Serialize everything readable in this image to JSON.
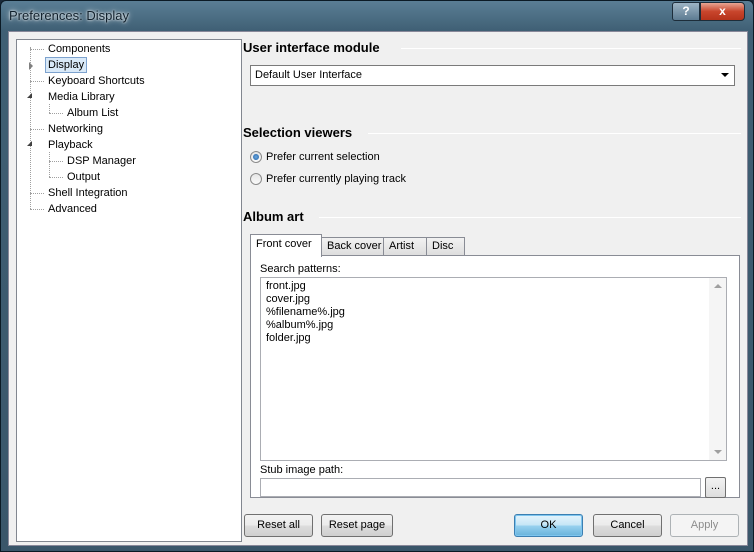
{
  "window": {
    "title": "Preferences: Display",
    "help_label": "?",
    "close_label": "x"
  },
  "tree": {
    "items": [
      {
        "label": "Components"
      },
      {
        "label": "Display"
      },
      {
        "label": "Keyboard Shortcuts"
      },
      {
        "label": "Media Library"
      },
      {
        "label": "Album List"
      },
      {
        "label": "Networking"
      },
      {
        "label": "Playback"
      },
      {
        "label": "DSP Manager"
      },
      {
        "label": "Output"
      },
      {
        "label": "Shell Integration"
      },
      {
        "label": "Advanced"
      }
    ]
  },
  "ui_module": {
    "header": "User interface module",
    "selected": "Default User Interface"
  },
  "selection_viewers": {
    "header": "Selection viewers",
    "options": [
      {
        "label": "Prefer current selection",
        "checked": true
      },
      {
        "label": "Prefer currently playing track",
        "checked": false
      }
    ]
  },
  "album_art": {
    "header": "Album art",
    "tabs": [
      "Front cover",
      "Back cover",
      "Artist",
      "Disc"
    ],
    "search_patterns_label": "Search patterns:",
    "patterns": [
      "front.jpg",
      "cover.jpg",
      "%filename%.jpg",
      "%album%.jpg",
      "folder.jpg"
    ],
    "stub_label": "Stub image path:",
    "stub_value": "",
    "browse_label": "..."
  },
  "buttons": {
    "reset_all": "Reset all",
    "reset_page": "Reset page",
    "ok": "OK",
    "cancel": "Cancel",
    "apply": "Apply"
  }
}
